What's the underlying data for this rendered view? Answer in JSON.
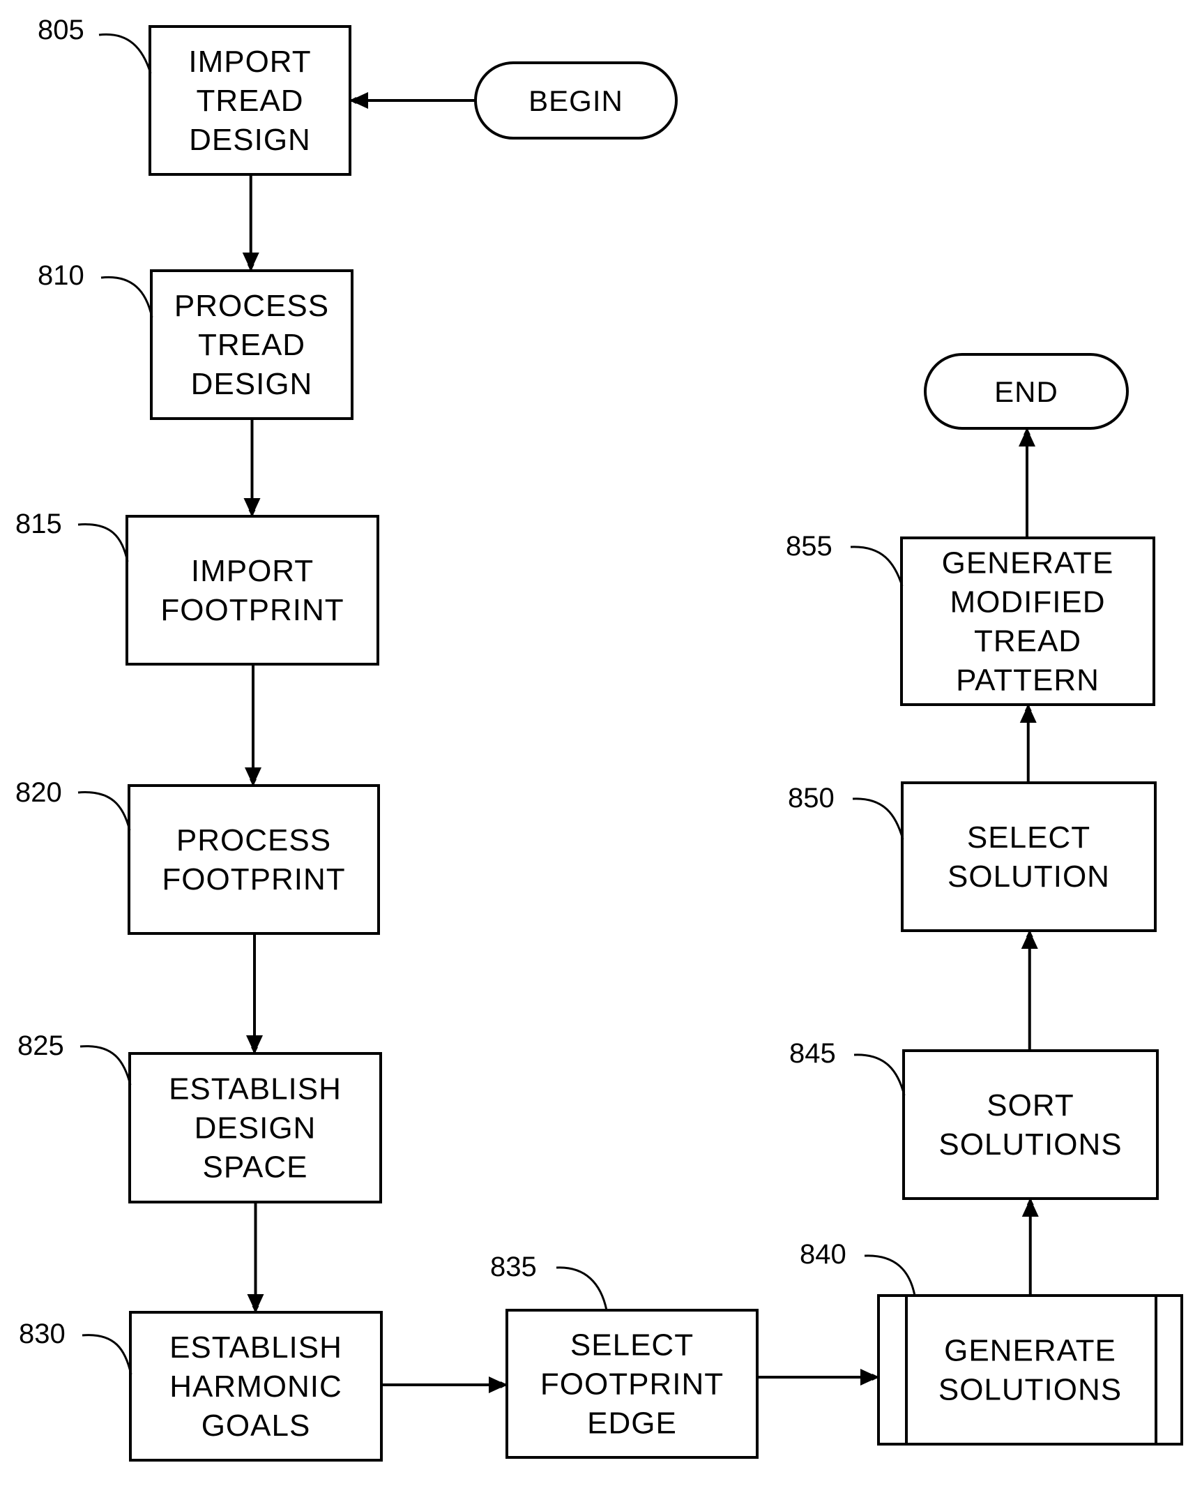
{
  "diagram": {
    "type": "flowchart",
    "terminals": {
      "begin": {
        "label": "BEGIN"
      },
      "end": {
        "label": "END"
      }
    },
    "steps": [
      {
        "id": "805",
        "ref": "805",
        "lines": [
          "IMPORT",
          "TREAD",
          "DESIGN"
        ],
        "shape": "process"
      },
      {
        "id": "810",
        "ref": "810",
        "lines": [
          "PROCESS",
          "TREAD",
          "DESIGN"
        ],
        "shape": "process"
      },
      {
        "id": "815",
        "ref": "815",
        "lines": [
          "IMPORT",
          "FOOTPRINT"
        ],
        "shape": "process"
      },
      {
        "id": "820",
        "ref": "820",
        "lines": [
          "PROCESS",
          "FOOTPRINT"
        ],
        "shape": "process"
      },
      {
        "id": "825",
        "ref": "825",
        "lines": [
          "ESTABLISH",
          "DESIGN",
          "SPACE"
        ],
        "shape": "process"
      },
      {
        "id": "830",
        "ref": "830",
        "lines": [
          "ESTABLISH",
          "HARMONIC",
          "GOALS"
        ],
        "shape": "process"
      },
      {
        "id": "835",
        "ref": "835",
        "lines": [
          "SELECT",
          "FOOTPRINT",
          "EDGE"
        ],
        "shape": "process"
      },
      {
        "id": "840",
        "ref": "840",
        "lines": [
          "GENERATE",
          "SOLUTIONS"
        ],
        "shape": "predefined-process"
      },
      {
        "id": "845",
        "ref": "845",
        "lines": [
          "SORT",
          "SOLUTIONS"
        ],
        "shape": "process"
      },
      {
        "id": "850",
        "ref": "850",
        "lines": [
          "SELECT",
          "SOLUTION"
        ],
        "shape": "process"
      },
      {
        "id": "855",
        "ref": "855",
        "lines": [
          "GENERATE",
          "MODIFIED",
          "TREAD",
          "PATTERN"
        ],
        "shape": "process"
      }
    ],
    "edges": [
      {
        "from": "begin",
        "to": "805"
      },
      {
        "from": "805",
        "to": "810"
      },
      {
        "from": "810",
        "to": "815"
      },
      {
        "from": "815",
        "to": "820"
      },
      {
        "from": "820",
        "to": "825"
      },
      {
        "from": "825",
        "to": "830"
      },
      {
        "from": "830",
        "to": "835"
      },
      {
        "from": "835",
        "to": "840"
      },
      {
        "from": "840",
        "to": "845"
      },
      {
        "from": "845",
        "to": "850"
      },
      {
        "from": "850",
        "to": "855"
      },
      {
        "from": "855",
        "to": "end"
      }
    ]
  }
}
